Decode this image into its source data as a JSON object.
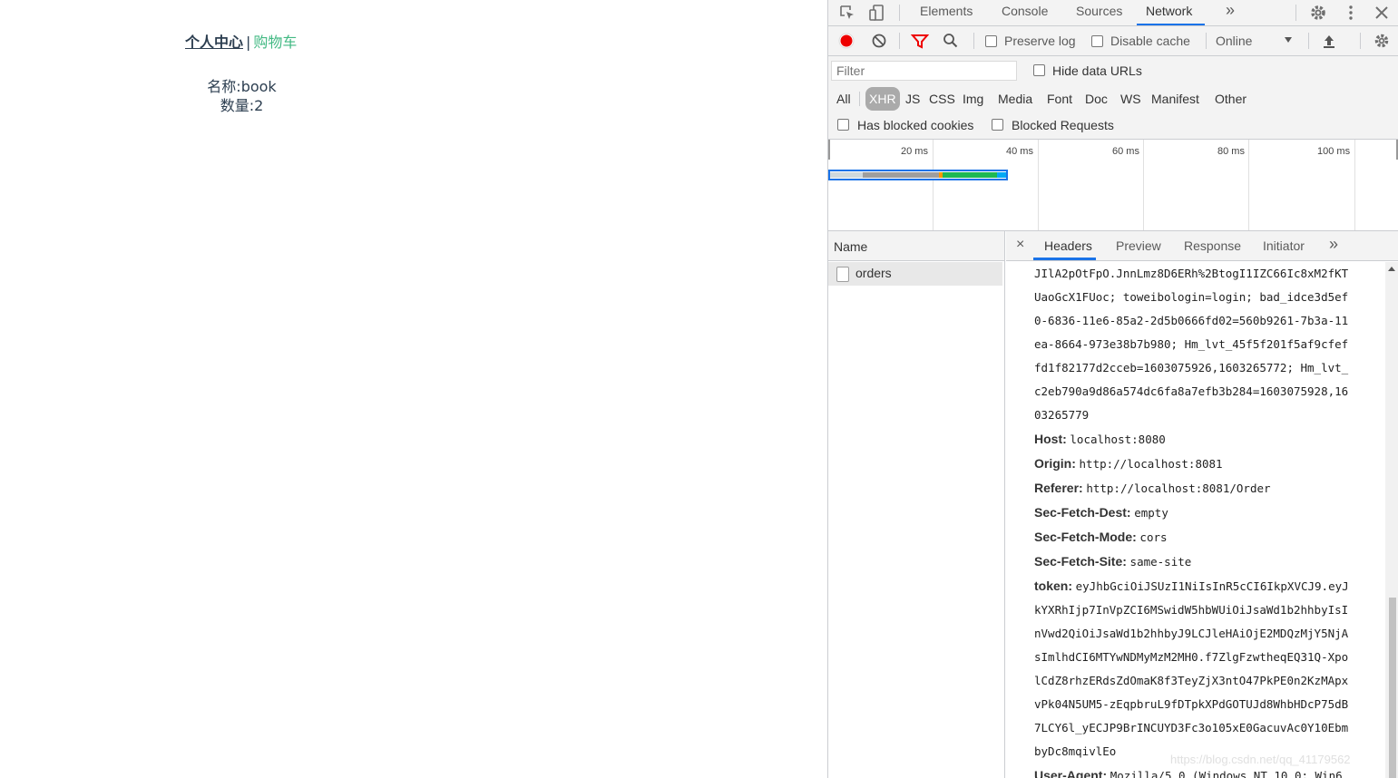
{
  "app": {
    "nav_personal": "个人中心",
    "nav_separator": "|",
    "nav_cart": "购物车",
    "item_name": "名称:book",
    "item_qty": "数量:2"
  },
  "devtools": {
    "main_tabs": [
      "Elements",
      "Console",
      "Sources",
      "Network"
    ],
    "more_tabs": "»",
    "toolbar": {
      "preserve_log": "Preserve log",
      "disable_cache": "Disable cache",
      "throttle": "Online"
    },
    "filter": {
      "placeholder": "Filter",
      "hide_data_urls": "Hide data URLs",
      "types": [
        "All",
        "XHR",
        "JS",
        "CSS",
        "Img",
        "Media",
        "Font",
        "Doc",
        "WS",
        "Manifest",
        "Other"
      ],
      "active_type": "XHR",
      "has_blocked_cookies": "Has blocked cookies",
      "blocked_requests": "Blocked Requests"
    },
    "overview_ticks": [
      "20 ms",
      "40 ms",
      "60 ms",
      "80 ms",
      "100 ms"
    ],
    "name_header": "Name",
    "requests": [
      "orders"
    ],
    "detail_tabs": [
      "Headers",
      "Preview",
      "Response",
      "Initiator"
    ],
    "detail_more": "»",
    "close_label": "×",
    "cookie_continuation": [
      "JIlA2pOtFpO.JnnLmz8D6ERh%2BtogI1IZC66Ic8xM2fKT",
      "UaoGcX1FUoc; toweibologin=login; bad_idce3d5ef",
      "0-6836-11e6-85a2-2d5b0666fd02=560b9261-7b3a-11",
      "ea-8664-973e38b7b980; Hm_lvt_45f5f201f5af9cfef",
      "fd1f82177d2cceb=1603075926,1603265772; Hm_lvt_",
      "c2eb790a9d86a574dc6fa8a7efb3b284=1603075928,16",
      "03265779"
    ],
    "headers": [
      {
        "name": "Host:",
        "value": "localhost:8080"
      },
      {
        "name": "Origin:",
        "value": "http://localhost:8081"
      },
      {
        "name": "Referer:",
        "value": "http://localhost:8081/Order"
      },
      {
        "name": "Sec-Fetch-Dest:",
        "value": "empty"
      },
      {
        "name": "Sec-Fetch-Mode:",
        "value": "cors"
      },
      {
        "name": "Sec-Fetch-Site:",
        "value": "same-site"
      },
      {
        "name": "token:",
        "value": "eyJhbGciOiJSUzI1NiIsInR5cCI6IkpXVCJ9.eyJ"
      }
    ],
    "token_continuation": [
      "kYXRhIjp7InVpZCI6MSwidW5hbWUiOiJsaWd1b2hhbyIsI",
      "nVwd2QiOiJsaWd1b2hhbyJ9LCJleHAiOjE2MDQzMjY5NjA",
      "sImlhdCI6MTYwNDMyMzM2MH0.f7ZlgFzwtheqEQ31Q-Xpo",
      "lCdZ8rhzERdsZdOmaK8f3TeyZjX3ntO47PkPE0n2KzMApx",
      "vPk04N5UM5-zEqpbruL9fDTpkXPdGOTUJd8WhbHDcP75dB",
      "7LCY6l_yECJP9BrINCUYD3Fc3o105xE0GacuvAc0Y10Ebm",
      "byDc8mqivlEo"
    ],
    "last_header": {
      "name": "User-Agent:",
      "value": "Mozilla/5.0 (Windows NT 10.0; Win6"
    }
  },
  "watermark": "https://blog.csdn.net/qq_41179562",
  "colors": {
    "link_green": "#42b983",
    "accent_blue": "#1a73e8",
    "record_red": "#d93025"
  }
}
